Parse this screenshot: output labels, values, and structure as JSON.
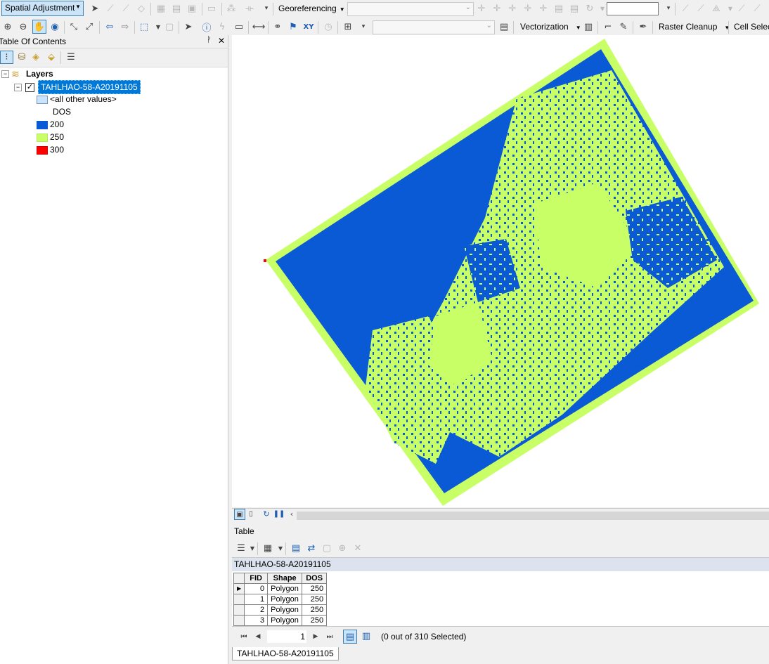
{
  "toolbar1": {
    "spatial_adjustment_label": "Spatial Adjustment",
    "georeferencing_label": "Georeferencing"
  },
  "toolbar2": {
    "vectorization_label": "Vectorization",
    "raster_cleanup_label": "Raster Cleanup",
    "cell_selection_label": "Cell Selec"
  },
  "toc": {
    "title": "Table Of Contents",
    "pin_glyph": "♒",
    "close_glyph": "✕",
    "layers_label": "Layers",
    "layer_name": "TAHLHAO-58-A20191105",
    "all_other_values": "<all other values>",
    "field_heading": "DOS",
    "legend": [
      {
        "label": "200",
        "color": "#0a5ad6"
      },
      {
        "label": "250",
        "color": "#c9ff66"
      },
      {
        "label": "300",
        "color": "#ff0000"
      }
    ]
  },
  "map": {
    "colors": {
      "low": "#0a5ad6",
      "mid": "#c9ff66",
      "high": "#ff0000"
    }
  },
  "table": {
    "window_title": "Table",
    "tab_label": "TAHLHAO-58-A20191105",
    "columns": [
      "FID",
      "Shape",
      "DOS"
    ],
    "rows": [
      [
        "0",
        "Polygon",
        "250"
      ],
      [
        "1",
        "Polygon",
        "250"
      ],
      [
        "2",
        "Polygon",
        "250"
      ],
      [
        "3",
        "Polygon",
        "250"
      ]
    ],
    "record_number": "1",
    "selection_status": "(0 out of 310 Selected)",
    "bottom_tab_label": "TAHLHAO-58-A20191105"
  }
}
